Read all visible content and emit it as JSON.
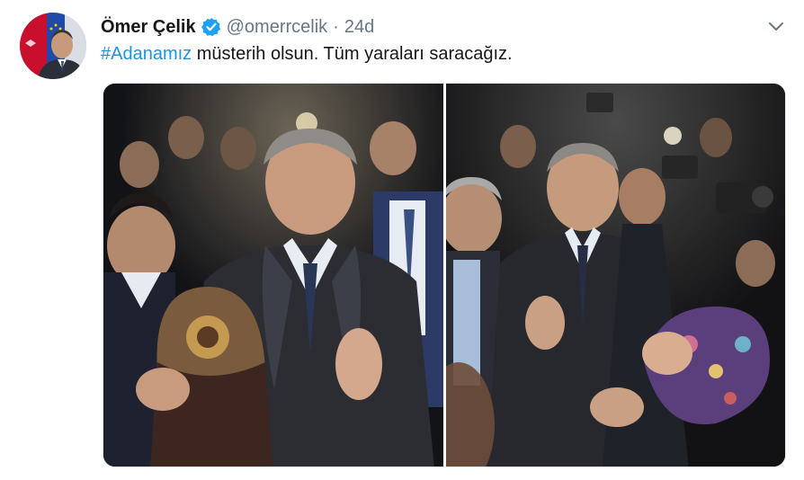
{
  "tweet": {
    "author_name": "Ömer Çelik",
    "handle": "@omerrcelik",
    "separator": "·",
    "time": "24d",
    "hashtag": "#Adanamız",
    "text_rest": " müsterih olsun. Tüm yaraları saracağız.",
    "icons": {
      "verified": "verified-badge-icon",
      "menu": "chevron-down-icon"
    }
  },
  "colors": {
    "link": "#1b95e0",
    "secondary_text": "#657786",
    "verified": "#1da1f2"
  }
}
